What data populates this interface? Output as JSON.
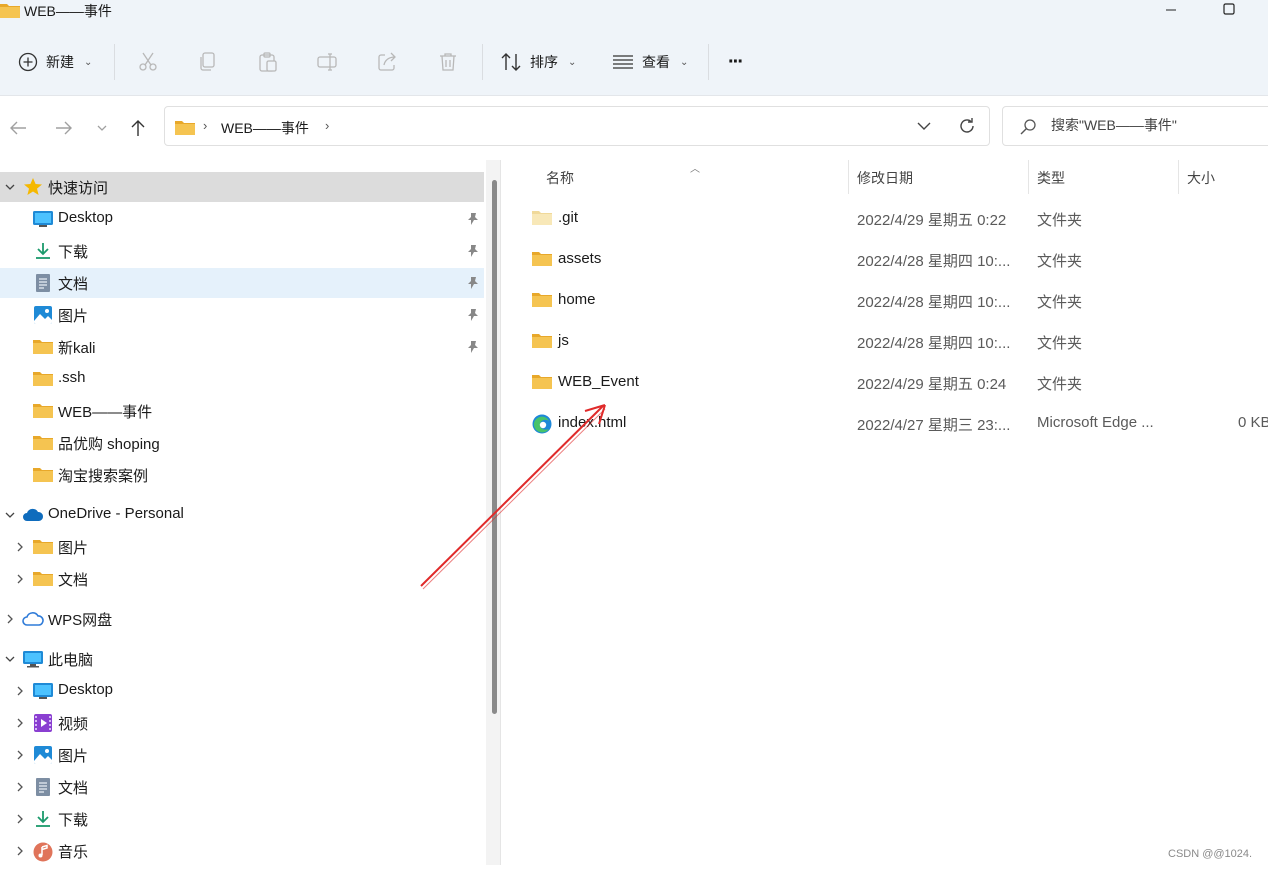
{
  "window": {
    "title": "WEB——事件"
  },
  "toolbar": {
    "new_label": "新建",
    "sort_label": "排序",
    "view_label": "查看",
    "more_label": "···"
  },
  "address": {
    "segment": "WEB——事件",
    "separator": "›"
  },
  "search": {
    "placeholder": "搜索\"WEB——事件\""
  },
  "sidebar": {
    "quick_access": "快速访问",
    "quick_items": [
      {
        "label": "Desktop",
        "icon": "desktop-icon"
      },
      {
        "label": "下载",
        "icon": "download-icon"
      },
      {
        "label": "文档",
        "icon": "document-icon"
      },
      {
        "label": "图片",
        "icon": "picture-icon"
      },
      {
        "label": "新kali",
        "icon": "folder-icon"
      },
      {
        "label": ".ssh",
        "icon": "folder-icon"
      },
      {
        "label": "WEB——事件",
        "icon": "folder-icon"
      },
      {
        "label": "品优购 shoping",
        "icon": "folder-icon"
      },
      {
        "label": "淘宝搜索案例",
        "icon": "folder-icon"
      }
    ],
    "onedrive": "OneDrive - Personal",
    "onedrive_items": [
      {
        "label": "图片"
      },
      {
        "label": "文档"
      }
    ],
    "wps": "WPS网盘",
    "this_pc": "此电脑",
    "pc_items": [
      {
        "label": "Desktop",
        "icon": "desktop-icon"
      },
      {
        "label": "视频",
        "icon": "video-icon"
      },
      {
        "label": "图片",
        "icon": "picture-icon"
      },
      {
        "label": "文档",
        "icon": "document-icon"
      },
      {
        "label": "下载",
        "icon": "download-icon"
      },
      {
        "label": "音乐",
        "icon": "music-icon"
      }
    ]
  },
  "columns": {
    "name": "名称",
    "date": "修改日期",
    "type": "类型",
    "size": "大小"
  },
  "files": [
    {
      "name": ".git",
      "date": "2022/4/29 星期五 0:22",
      "type": "文件夹",
      "size": "",
      "icon": "folder-icon"
    },
    {
      "name": "assets",
      "date": "2022/4/28 星期四 10:...",
      "type": "文件夹",
      "size": "",
      "icon": "folder-icon"
    },
    {
      "name": "home",
      "date": "2022/4/28 星期四 10:...",
      "type": "文件夹",
      "size": "",
      "icon": "folder-icon"
    },
    {
      "name": "js",
      "date": "2022/4/28 星期四 10:...",
      "type": "文件夹",
      "size": "",
      "icon": "folder-icon"
    },
    {
      "name": "WEB_Event",
      "date": "2022/4/29 星期五 0:24",
      "type": "文件夹",
      "size": "",
      "icon": "folder-icon"
    },
    {
      "name": "index.html",
      "date": "2022/4/27 星期三 23:...",
      "type": "Microsoft Edge ...",
      "size": "0 KB",
      "icon": "edge-icon"
    }
  ],
  "watermark": "CSDN @@1024.",
  "colors": {
    "chrome_bg": "#eff4f9",
    "folder_yellow": "#f5c451",
    "annotation_red": "#e02a2a",
    "selection_gray": "#dcdcdc",
    "hover_blue": "#e5f1fb"
  }
}
